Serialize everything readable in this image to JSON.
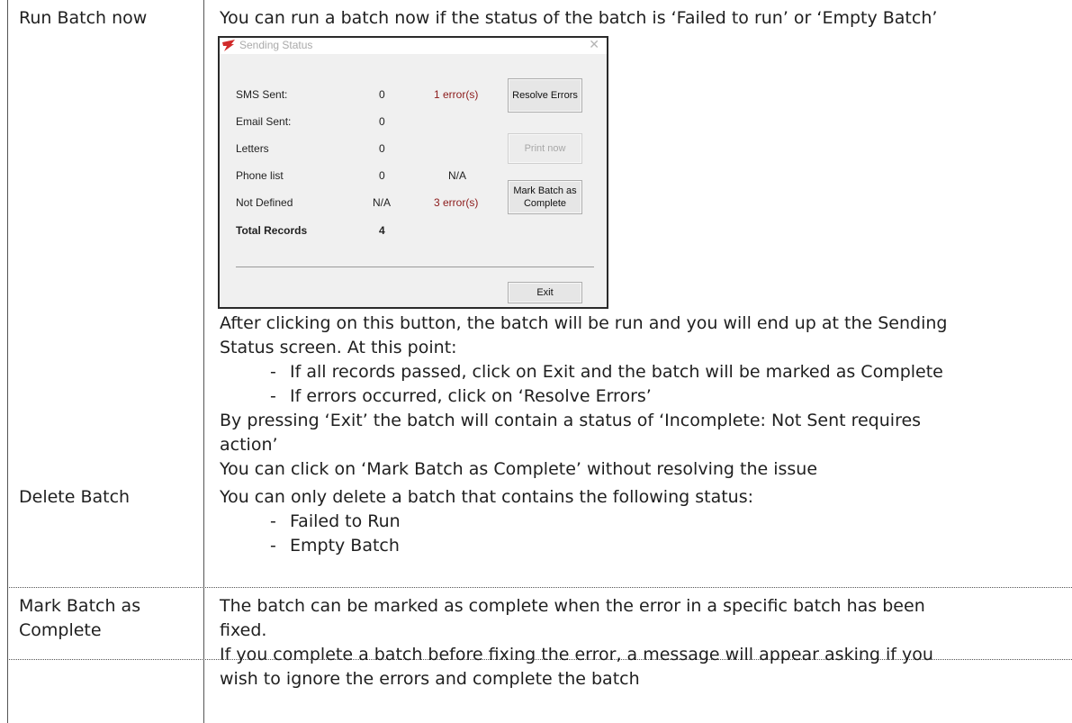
{
  "rows": [
    {
      "label": "Run Batch now",
      "intro": "You can run a batch now if the status of the batch is ‘Failed to run’ or ‘Empty Batch’",
      "after_1": "After clicking on this button, the batch will be run and you will end up at the Sending",
      "after_2": "Status screen. At this point:",
      "bullets": [
        "If all records passed, click on Exit and the batch will be marked as Complete",
        "If errors occurred, click on ‘Resolve Errors’"
      ],
      "exit_note_1": "By pressing ‘Exit’ the batch will contain a status of ‘Incomplete: Not Sent requires",
      "exit_note_2": "action’",
      "mark_note": "You can click on ‘Mark Batch as Complete’ without resolving the issue"
    },
    {
      "label": "Delete Batch",
      "intro": "You can only delete a batch that contains the following status:",
      "bullets": [
        "Failed to Run",
        "Empty Batch"
      ]
    },
    {
      "label_1": "Mark Batch as",
      "label_2": "Complete",
      "text_1": "The batch can be marked as complete when the error in a specific batch has been",
      "text_2": "fixed.",
      "text_3": "If you complete a batch before fixing the error, a message will appear asking if you",
      "text_4": "wish to ignore the errors and complete the batch"
    }
  ],
  "bullet_dash": "-",
  "dialog": {
    "title": "Sending Status",
    "close_glyph": "✕",
    "lines": [
      {
        "label": "SMS Sent:",
        "count": "0",
        "extra": "1 error(s)"
      },
      {
        "label": "Email Sent:",
        "count": "0",
        "extra": ""
      },
      {
        "label": "Letters",
        "count": "0",
        "extra": ""
      },
      {
        "label": "Phone list",
        "count": "0",
        "extra": "N/A"
      },
      {
        "label": "Not Defined",
        "count": "N/A",
        "extra": "3 error(s)"
      }
    ],
    "total_label": "Total Records",
    "total_value": "4",
    "buttons": {
      "resolve": "Resolve Errors",
      "print": "Print now",
      "mark_1": "Mark Batch as",
      "mark_2": "Complete",
      "exit": "Exit"
    },
    "colors": {
      "error": "#8b1a1a",
      "icon": "#d12a2a"
    }
  }
}
